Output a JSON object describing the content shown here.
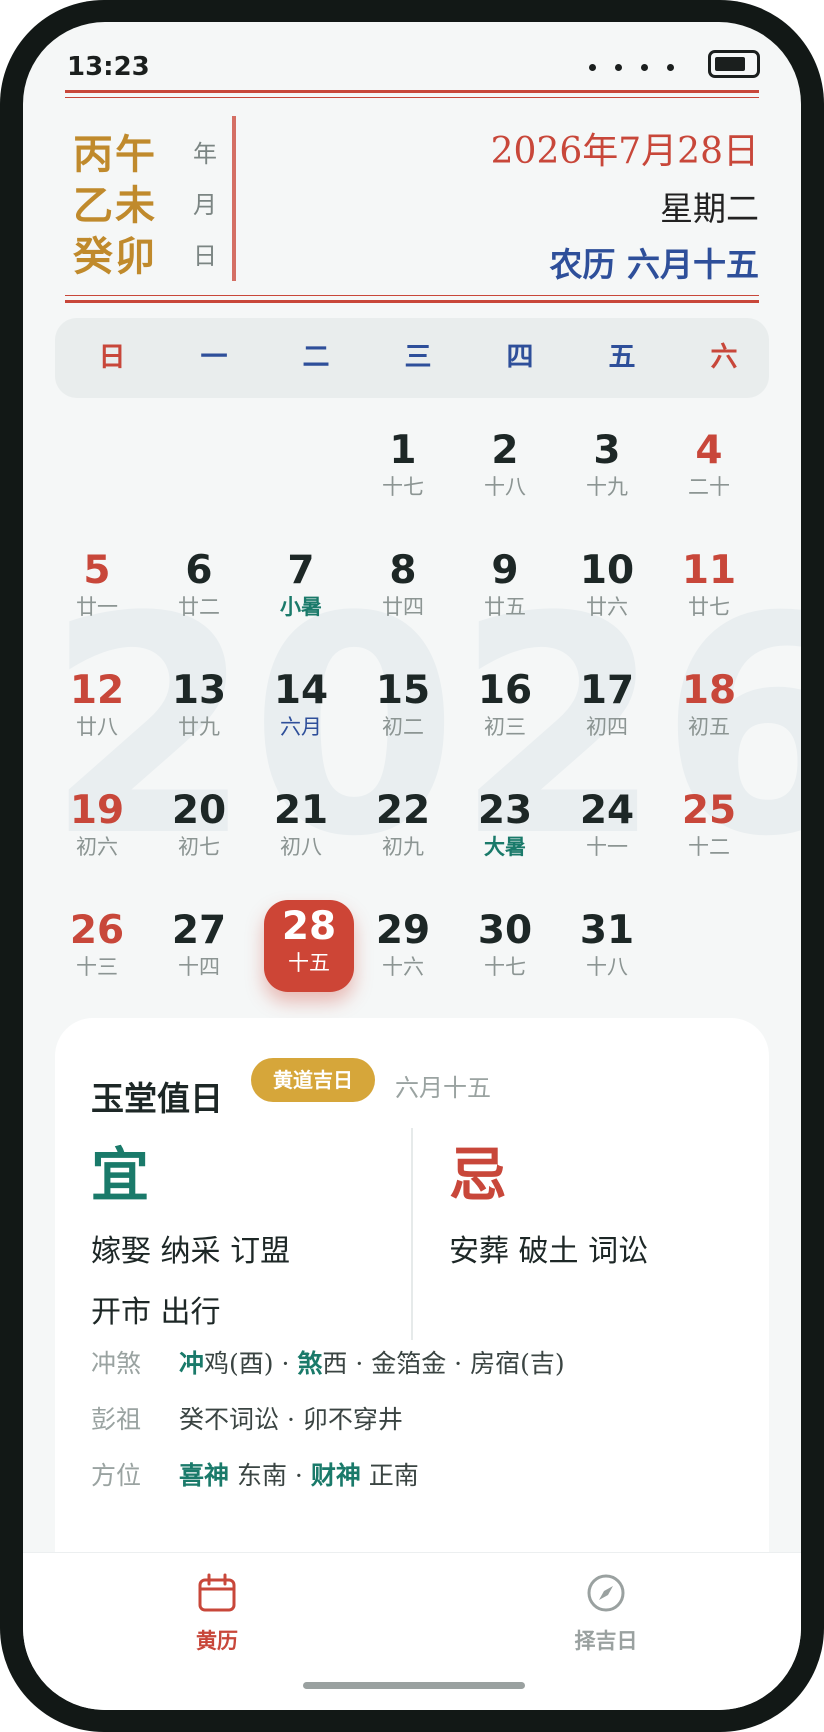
{
  "status_bar": {
    "time": "13:23"
  },
  "header": {
    "ganzhi": [
      {
        "chars": "丙午",
        "unit": "年"
      },
      {
        "chars": "乙未",
        "unit": "月"
      },
      {
        "chars": "癸卯",
        "unit": "日"
      }
    ],
    "date": "2026年7月28日",
    "weekday": "星期二",
    "lunar": "农历 六月十五"
  },
  "weekdays": [
    "日",
    "一",
    "二",
    "三",
    "四",
    "五",
    "六"
  ],
  "watermark": "2026",
  "days": [
    {
      "d": "1",
      "l": "十七"
    },
    {
      "d": "2",
      "l": "十八"
    },
    {
      "d": "3",
      "l": "十九"
    },
    {
      "d": "4",
      "l": "二十"
    },
    {
      "d": "5",
      "l": "廿一"
    },
    {
      "d": "6",
      "l": "廿二"
    },
    {
      "d": "7",
      "l": "小暑"
    },
    {
      "d": "8",
      "l": "廿四"
    },
    {
      "d": "9",
      "l": "廿五"
    },
    {
      "d": "10",
      "l": "廿六"
    },
    {
      "d": "11",
      "l": "廿七"
    },
    {
      "d": "12",
      "l": "廿八"
    },
    {
      "d": "13",
      "l": "廿九"
    },
    {
      "d": "14",
      "l": "六月"
    },
    {
      "d": "15",
      "l": "初二"
    },
    {
      "d": "16",
      "l": "初三"
    },
    {
      "d": "17",
      "l": "初四"
    },
    {
      "d": "18",
      "l": "初五"
    },
    {
      "d": "19",
      "l": "初六"
    },
    {
      "d": "20",
      "l": "初七"
    },
    {
      "d": "21",
      "l": "初八"
    },
    {
      "d": "22",
      "l": "初九"
    },
    {
      "d": "23",
      "l": "大暑"
    },
    {
      "d": "24",
      "l": "十一"
    },
    {
      "d": "25",
      "l": "十二"
    },
    {
      "d": "26",
      "l": "十三"
    },
    {
      "d": "27",
      "l": "十四"
    },
    {
      "d": "28",
      "l": "十五"
    },
    {
      "d": "29",
      "l": "十六"
    },
    {
      "d": "30",
      "l": "十七"
    },
    {
      "d": "31",
      "l": "十八"
    }
  ],
  "card": {
    "title": "玉堂值日",
    "badge": "黄道吉日",
    "lunar": "六月十五",
    "yi_char": "宜",
    "ji_char": "忌",
    "yi": [
      "嫁娶 纳采 订盟",
      "开市 出行"
    ],
    "ji": [
      "安葬 破土 词讼"
    ],
    "chongsha": {
      "label": "冲煞",
      "chong": "冲",
      "chong_text": "鸡(酉) · ",
      "sha": "煞",
      "sha_text": "西 · 金箔金 · 房宿(吉)"
    },
    "pengzu": {
      "label": "彭祖",
      "text": "癸不词讼 · 卯不穿井"
    },
    "fangwei": {
      "label": "方位",
      "xi": "喜神",
      "xi_text": " 东南 · ",
      "cai": "财神",
      "cai_text": " 正南"
    }
  },
  "tabs": [
    {
      "label": "黄历",
      "icon": "calendar-icon",
      "active": true
    },
    {
      "label": "择吉日",
      "icon": "compass-icon",
      "active": false
    }
  ],
  "colors": {
    "red": "#c8473a",
    "gold": "#c08a2c",
    "blue": "#2e4f9a",
    "green": "#1a7a6a"
  }
}
